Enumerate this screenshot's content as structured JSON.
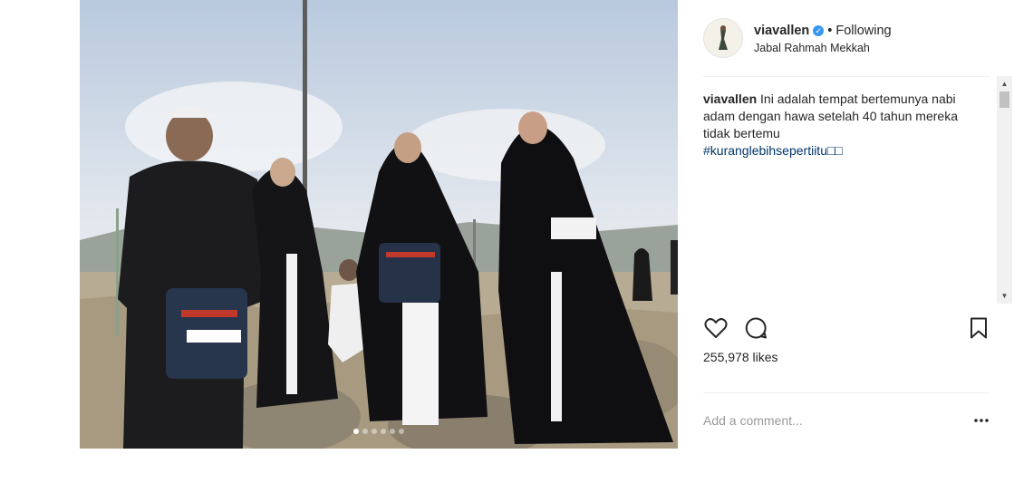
{
  "post": {
    "username": "viavallen",
    "verified_icon": "verified-badge-icon",
    "bullet": "•",
    "follow_status": "Following",
    "location": "Jabal Rahmah Mekkah"
  },
  "caption": {
    "username": "viavallen",
    "text": "Ini adalah tempat bertemunya nabi adam dengan hawa setelah 40 tahun mereka tidak bertemu",
    "hashtag": "#kuranglebihsepertiitu□□"
  },
  "actions": {
    "like_icon": "heart-icon",
    "comment_icon": "comment-icon",
    "save_icon": "bookmark-icon"
  },
  "likes": "255,978 likes",
  "comment": {
    "placeholder": "Add a comment...",
    "more_icon": "more-options-icon"
  },
  "carousel": {
    "slide_count": 6,
    "active_index": 0
  },
  "colors": {
    "link": "#003569",
    "verified": "#3897f0",
    "text": "#262626",
    "muted": "#999999"
  }
}
